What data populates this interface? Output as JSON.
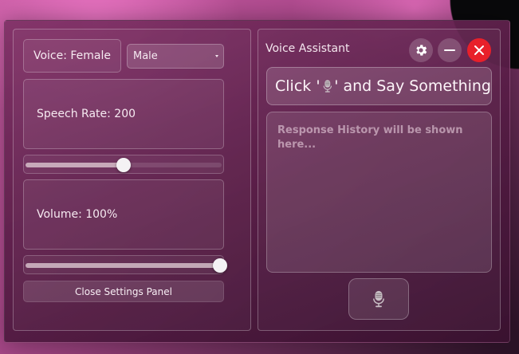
{
  "window": {
    "title": "Voice Assistant"
  },
  "settings": {
    "voice_label": "Voice: Female",
    "voice_select": {
      "selected": "Male"
    },
    "speech_rate_label": "Speech Rate: 200",
    "speech_rate_fraction": 0.5,
    "volume_label": "Volume: 100%",
    "volume_fraction": 1.0,
    "close_panel_label": "Close Settings Panel"
  },
  "assistant": {
    "prompt_prefix": "Click '",
    "prompt_suffix": "' and Say Something",
    "history_placeholder": "Response History will be shown here..."
  },
  "icons": {
    "settings": "gear-icon",
    "minimize": "minus-icon",
    "close": "close-icon",
    "mic": "microphone-icon"
  },
  "colors": {
    "close_button": "#e8202a",
    "accent_pink": "#c45aa0"
  }
}
